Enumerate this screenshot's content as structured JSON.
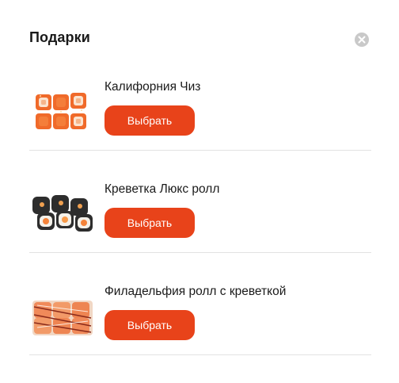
{
  "modal": {
    "title": "Подарки",
    "close_icon": "close-icon"
  },
  "gifts": [
    {
      "name": "Калифорния Чиз",
      "button": "Выбрать",
      "image": "california-cheese-roll-image"
    },
    {
      "name": "Креветка Люкс ролл",
      "button": "Выбрать",
      "image": "shrimp-lux-roll-image"
    },
    {
      "name": "Филадельфия ролл с креветкой",
      "button": "Выбрать",
      "image": "philadelphia-shrimp-roll-image"
    }
  ],
  "colors": {
    "accent": "#e8431a",
    "close_bg": "#c9c9c9",
    "divider": "#e2e2e2"
  }
}
